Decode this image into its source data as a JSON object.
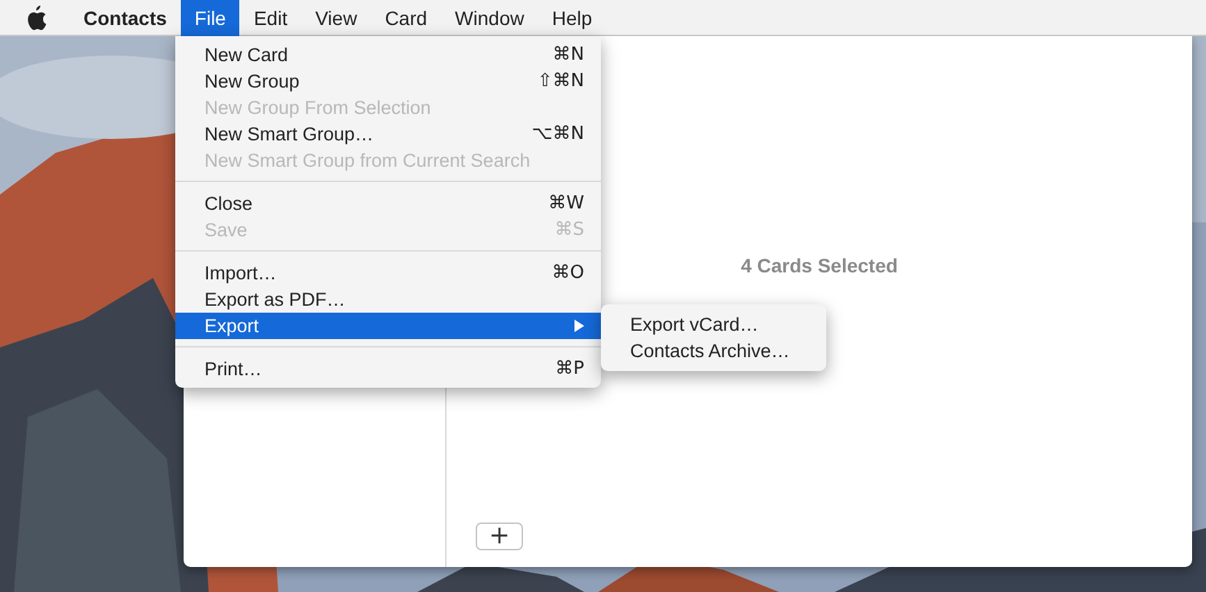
{
  "menubar": {
    "app_name": "Contacts",
    "menus": [
      {
        "label": "File",
        "selected": true
      },
      {
        "label": "Edit",
        "selected": false
      },
      {
        "label": "View",
        "selected": false
      },
      {
        "label": "Card",
        "selected": false
      },
      {
        "label": "Window",
        "selected": false
      },
      {
        "label": "Help",
        "selected": false
      }
    ]
  },
  "file_menu": {
    "items": [
      {
        "kind": "item",
        "label": "New Card",
        "shortcut": "⌘N",
        "disabled": false,
        "selected": false
      },
      {
        "kind": "item",
        "label": "New Group",
        "shortcut": "⇧⌘N",
        "disabled": false,
        "selected": false
      },
      {
        "kind": "item",
        "label": "New Group From Selection",
        "disabled": true,
        "selected": false
      },
      {
        "kind": "item",
        "label": "New Smart Group…",
        "shortcut": "⌥⌘N",
        "disabled": false,
        "selected": false
      },
      {
        "kind": "item",
        "label": "New Smart Group from Current Search",
        "disabled": true,
        "selected": false
      },
      {
        "kind": "separator"
      },
      {
        "kind": "item",
        "label": "Close",
        "shortcut": "⌘W",
        "disabled": false,
        "selected": false
      },
      {
        "kind": "item",
        "label": "Save",
        "shortcut": "⌘S",
        "disabled": true,
        "selected": false
      },
      {
        "kind": "separator"
      },
      {
        "kind": "item",
        "label": "Import…",
        "shortcut": "⌘O",
        "disabled": false,
        "selected": false
      },
      {
        "kind": "item",
        "label": "Export as PDF…",
        "disabled": false,
        "selected": false
      },
      {
        "kind": "submenu",
        "label": "Export",
        "disabled": false,
        "selected": true
      },
      {
        "kind": "separator"
      },
      {
        "kind": "item",
        "label": "Print…",
        "shortcut": "⌘P",
        "disabled": false,
        "selected": false
      }
    ]
  },
  "export_submenu": {
    "items": [
      {
        "label": "Export vCard…",
        "selected": false
      },
      {
        "label": "Contacts Archive…",
        "selected": false
      }
    ]
  },
  "contacts_window": {
    "selection_summary": "4 Cards Selected",
    "add_button": "+"
  }
}
